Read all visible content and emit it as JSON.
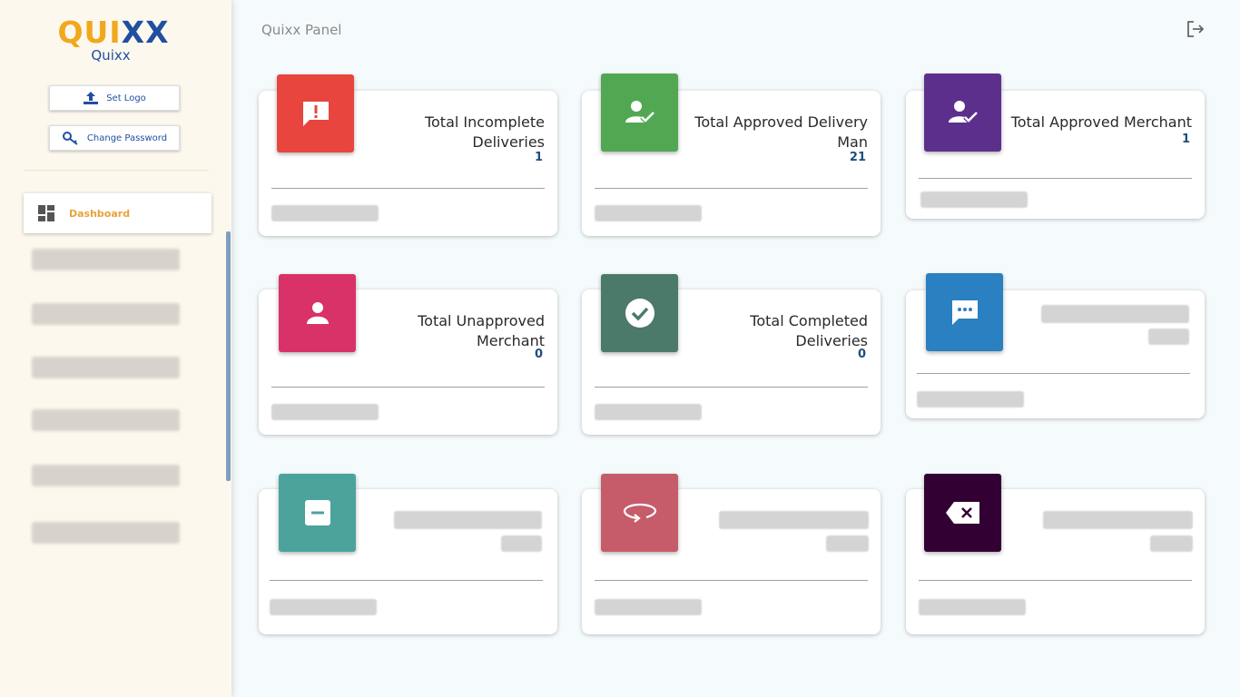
{
  "brand": {
    "logo_text_a": "QUI",
    "logo_text_b": "XX",
    "name": "Quixx"
  },
  "sidebar": {
    "set_logo_label": "Set Logo",
    "change_password_label": "Change Password",
    "nav_active_label": "Dashboard"
  },
  "header": {
    "title": "Quixx Panel"
  },
  "cards": [
    {
      "title": "Total Incomplete Deliveries",
      "count": "1",
      "color": "#e8453f",
      "icon": "alert-message-icon"
    },
    {
      "title": "Total Approved Delivery Man",
      "count": "21",
      "color": "#52a852",
      "icon": "user-check-icon"
    },
    {
      "title": "Total Approved Merchant",
      "count": "1",
      "color": "#5d2f8c",
      "icon": "user-check-icon"
    },
    {
      "title": "Total Unapproved Merchant",
      "count": "0",
      "color": "#d83268",
      "icon": "person-icon"
    },
    {
      "title": "Total Completed Deliveries",
      "count": "0",
      "color": "#4b7a6b",
      "icon": "check-circle-icon"
    },
    {
      "title": "",
      "count": "",
      "color": "#2a80c0",
      "icon": "chat-dots-icon"
    },
    {
      "title": "",
      "count": "",
      "color": "#4ba39c",
      "icon": "minus-box-icon"
    },
    {
      "title": "",
      "count": "",
      "color": "#c65c6a",
      "icon": "rotate-icon"
    },
    {
      "title": "",
      "count": "",
      "color": "#330033",
      "icon": "backspace-icon"
    }
  ]
}
